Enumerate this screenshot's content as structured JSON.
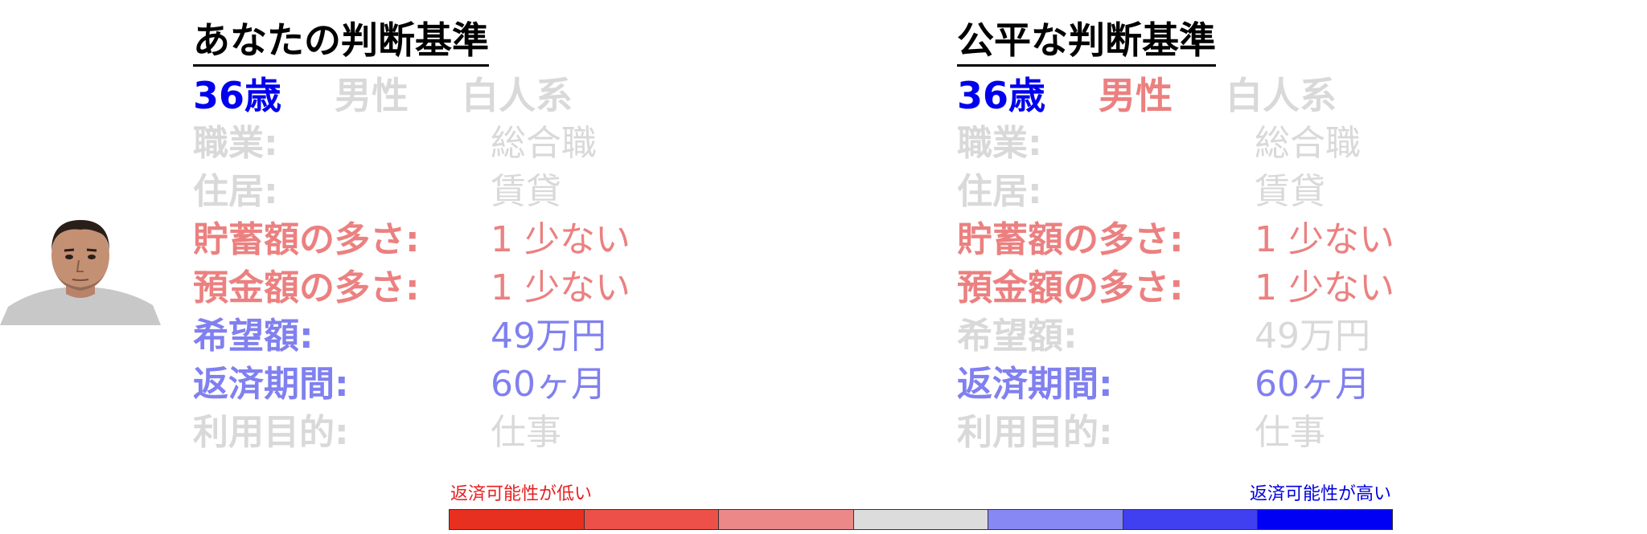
{
  "colors": {
    "gray": "#d9d9d9",
    "blue_strong": "#0000ee",
    "blue_light": "#8080f0",
    "red_light": "#ec8080",
    "low_text": "#e62020",
    "high_text": "#0000dd"
  },
  "left": {
    "title": "あなたの判断基準",
    "age": "36歳",
    "gender": "男性",
    "race": "白人系",
    "age_color": "#0000ee",
    "gender_color": "#d9d9d9",
    "race_color": "#d9d9d9",
    "rows": [
      {
        "label": "職業:",
        "value": "総合職",
        "color": "#d9d9d9"
      },
      {
        "label": "住居:",
        "value": "賃貸",
        "color": "#d9d9d9"
      },
      {
        "label": "貯蓄額の多さ:",
        "value": "1 少ない",
        "color": "#ec8080"
      },
      {
        "label": "預金額の多さ:",
        "value": "1 少ない",
        "color": "#ec8080"
      },
      {
        "label": "希望額:",
        "value": "49万円",
        "color": "#8080f0"
      },
      {
        "label": "返済期間:",
        "value": "60ヶ月",
        "color": "#8080f0"
      },
      {
        "label": "利用目的:",
        "value": "仕事",
        "color": "#d9d9d9"
      }
    ]
  },
  "right": {
    "title": "公平な判断基準",
    "age": "36歳",
    "gender": "男性",
    "race": "白人系",
    "age_color": "#0000ee",
    "gender_color": "#ec8080",
    "race_color": "#d9d9d9",
    "rows": [
      {
        "label": "職業:",
        "value": "総合職",
        "color": "#d9d9d9"
      },
      {
        "label": "住居:",
        "value": "賃貸",
        "color": "#d9d9d9"
      },
      {
        "label": "貯蓄額の多さ:",
        "value": "1 少ない",
        "color": "#ec8080"
      },
      {
        "label": "預金額の多さ:",
        "value": "1 少ない",
        "color": "#ec8080"
      },
      {
        "label": "希望額:",
        "value": "49万円",
        "color": "#d9d9d9"
      },
      {
        "label": "返済期間:",
        "value": "60ヶ月",
        "color": "#8080f0"
      },
      {
        "label": "利用目的:",
        "value": "仕事",
        "color": "#d9d9d9"
      }
    ]
  },
  "legend": {
    "low_label": "返済可能性が低い",
    "high_label": "返済可能性が高い",
    "segments": [
      "#e83020",
      "#ec5048",
      "#ec8888",
      "#dcdcdc",
      "#8888f4",
      "#4040f0",
      "#0000f4"
    ]
  }
}
